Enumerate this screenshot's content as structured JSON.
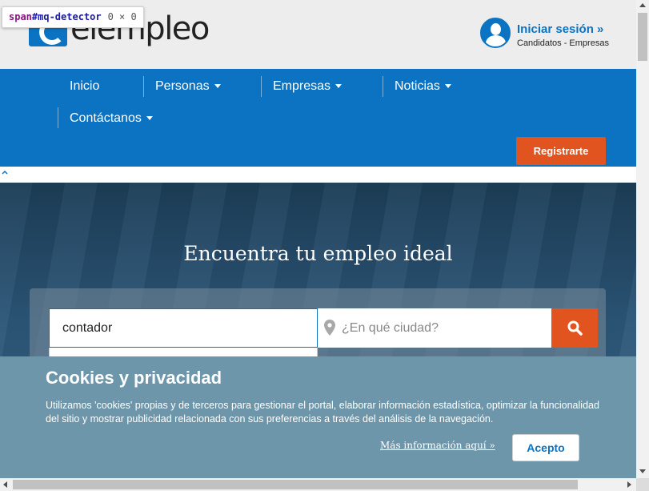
{
  "devtools_tooltip": {
    "tag": "span",
    "selector": "#mq-detector",
    "dimensions": "0 × 0"
  },
  "header": {
    "logo_text": "elempleo",
    "login": {
      "title": "Iniciar sesión »",
      "subtitle": "Candidatos - Empresas"
    }
  },
  "nav": {
    "items": [
      {
        "label": "Inicio"
      },
      {
        "label": "Personas"
      },
      {
        "label": "Empresas"
      },
      {
        "label": "Noticias"
      },
      {
        "label": "Contáctanos"
      }
    ],
    "register_label": "Registrarte"
  },
  "hero": {
    "title": "Encuentra tu empleo ideal",
    "keyword_value": "contador",
    "city_placeholder": "¿En qué ciudad?"
  },
  "cookie": {
    "title": "Cookies y privacidad",
    "text": "Utilizamos 'cookies' propias y de terceros para gestionar el portal, elaborar información estadística, optimizar la funcionalidad del sitio y mostrar publicidad relacionada con sus preferencias a través del análisis de la navegación.",
    "more_link": "Más información aquí »",
    "accept_label": "Acepto"
  },
  "colors": {
    "brand_blue": "#0b73c2",
    "accent_orange": "#e1541f",
    "cookie_bg": "#6d96ab"
  },
  "icons": [
    "user-avatar-icon",
    "map-pin-icon",
    "search-icon",
    "chevron-up-icon",
    "caret-down-icon"
  ]
}
